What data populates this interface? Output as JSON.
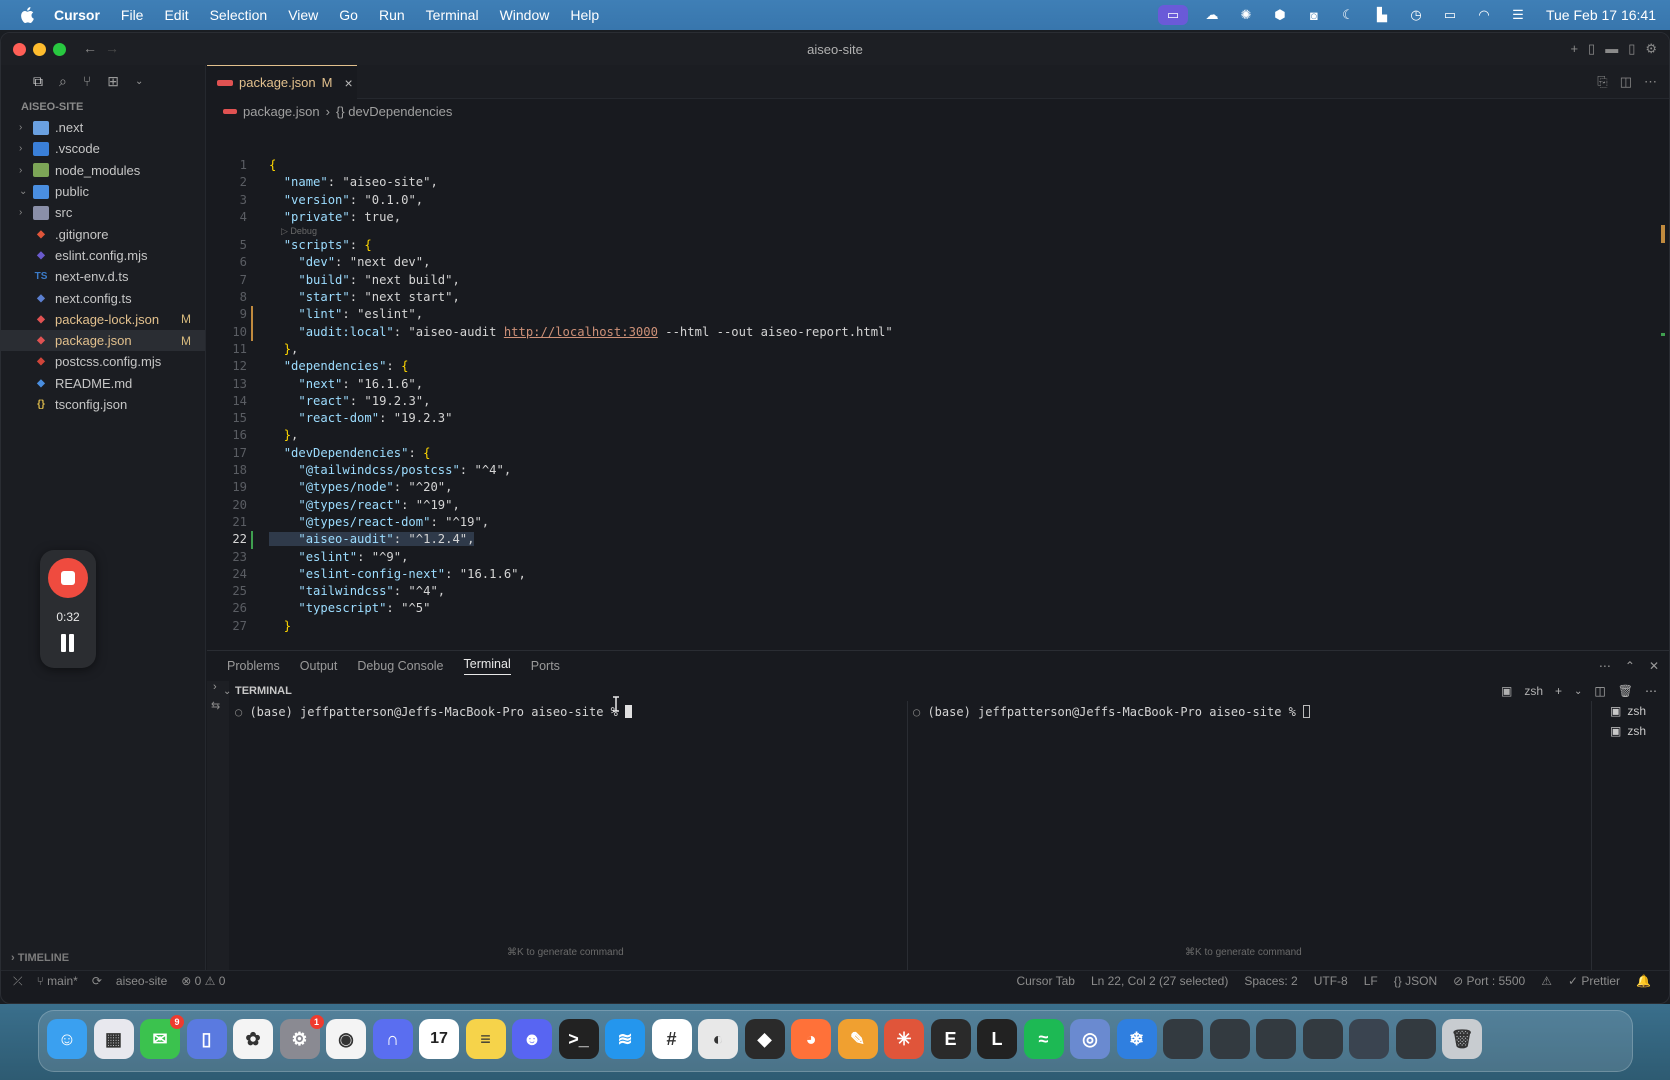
{
  "menubar": {
    "app_name": "Cursor",
    "items": [
      "File",
      "Edit",
      "Selection",
      "View",
      "Go",
      "Run",
      "Terminal",
      "Window",
      "Help"
    ],
    "clock": "Tue Feb 17  16:41"
  },
  "window": {
    "title": "aiseo-site"
  },
  "explorer": {
    "section_title": "AISEO-SITE",
    "items": [
      {
        "name": ".next",
        "type": "folder",
        "icon": "folder-icon",
        "color": "#6aa0e0"
      },
      {
        "name": ".vscode",
        "type": "folder",
        "icon": "folder-icon",
        "color": "#3a7fd8"
      },
      {
        "name": "node_modules",
        "type": "folder",
        "icon": "folder-icon",
        "color": "#7ca557"
      },
      {
        "name": "public",
        "type": "folder",
        "icon": "folder-open-icon",
        "color": "#4a8ee0"
      },
      {
        "name": "src",
        "type": "folder",
        "icon": "folder-icon",
        "color": "#8a8fa8"
      },
      {
        "name": ".gitignore",
        "type": "file",
        "icon": "git-icon",
        "color": "#e0553a"
      },
      {
        "name": "eslint.config.mjs",
        "type": "file",
        "icon": "eslint-icon",
        "color": "#6a5acd"
      },
      {
        "name": "next-env.d.ts",
        "type": "file",
        "icon": "ts-icon",
        "color": "#3b7bc8"
      },
      {
        "name": "next.config.ts",
        "type": "file",
        "icon": "next-icon",
        "color": "#5b7fd0"
      },
      {
        "name": "package-lock.json",
        "type": "file",
        "icon": "npm-icon",
        "color": "#e05252",
        "badge": "M"
      },
      {
        "name": "package.json",
        "type": "file",
        "icon": "npm-icon",
        "color": "#e05252",
        "badge": "M"
      },
      {
        "name": "postcss.config.mjs",
        "type": "file",
        "icon": "postcss-icon",
        "color": "#d0453a"
      },
      {
        "name": "README.md",
        "type": "file",
        "icon": "markdown-icon",
        "color": "#4a8ee0"
      },
      {
        "name": "tsconfig.json",
        "type": "file",
        "icon": "json-icon",
        "color": "#d7b64a"
      }
    ],
    "timeline_label": "TIMELINE"
  },
  "recorder": {
    "elapsed": "0:32"
  },
  "editor": {
    "tab": {
      "name": "package.json",
      "mark": "M"
    },
    "breadcrumb": [
      "package.json",
      "{} devDependencies"
    ],
    "debug_lens": "▷ Debug",
    "lines": [
      {
        "n": "1",
        "text": "{"
      },
      {
        "n": "2",
        "text": "  \"name\": \"aiseo-site\","
      },
      {
        "n": "3",
        "text": "  \"version\": \"0.1.0\","
      },
      {
        "n": "4",
        "text": "  \"private\": true,"
      },
      {
        "n": "5",
        "text": "  \"scripts\": {"
      },
      {
        "n": "6",
        "text": "    \"dev\": \"next dev\","
      },
      {
        "n": "7",
        "text": "    \"build\": \"next build\","
      },
      {
        "n": "8",
        "text": "    \"start\": \"next start\","
      },
      {
        "n": "9",
        "text": "    \"lint\": \"eslint\","
      },
      {
        "n": "10",
        "text": "    \"audit:local\": \"aiseo-audit http://localhost:3000 --html --out aiseo-report.html\""
      },
      {
        "n": "11",
        "text": "  },"
      },
      {
        "n": "12",
        "text": "  \"dependencies\": {"
      },
      {
        "n": "13",
        "text": "    \"next\": \"16.1.6\","
      },
      {
        "n": "14",
        "text": "    \"react\": \"19.2.3\","
      },
      {
        "n": "15",
        "text": "    \"react-dom\": \"19.2.3\""
      },
      {
        "n": "16",
        "text": "  },"
      },
      {
        "n": "17",
        "text": "  \"devDependencies\": {"
      },
      {
        "n": "18",
        "text": "    \"@tailwindcss/postcss\": \"^4\","
      },
      {
        "n": "19",
        "text": "    \"@types/node\": \"^20\","
      },
      {
        "n": "20",
        "text": "    \"@types/react\": \"^19\","
      },
      {
        "n": "21",
        "text": "    \"@types/react-dom\": \"^19\","
      },
      {
        "n": "22",
        "text": "    \"aiseo-audit\": \"^1.2.4\","
      },
      {
        "n": "23",
        "text": "    \"eslint\": \"^9\","
      },
      {
        "n": "24",
        "text": "    \"eslint-config-next\": \"16.1.6\","
      },
      {
        "n": "25",
        "text": "    \"tailwindcss\": \"^4\","
      },
      {
        "n": "26",
        "text": "    \"typescript\": \"^5\""
      },
      {
        "n": "27",
        "text": "  }"
      }
    ],
    "active_line": "22"
  },
  "panel": {
    "tabs": [
      "Problems",
      "Output",
      "Debug Console",
      "Terminal",
      "Ports"
    ],
    "active_tab": "Terminal",
    "terminal_header": "TERMINAL",
    "shell_label": "zsh",
    "prompt_left": "(base) jeffpatterson@Jeffs-MacBook-Pro aiseo-site % ",
    "prompt_right": "(base) jeffpatterson@Jeffs-MacBook-Pro aiseo-site % ",
    "hint_left": "⌘K to generate command",
    "hint_right": "⌘K to generate command",
    "terminal_list": [
      "zsh",
      "zsh"
    ]
  },
  "statusbar": {
    "branch": "main*",
    "workspace": "aiseo-site",
    "problems": "⊗ 0 ⚠ 0",
    "cursor_tab": "Cursor Tab",
    "position": "Ln 22, Col 2 (27 selected)",
    "spaces": "Spaces: 2",
    "encoding": "UTF-8",
    "eol": "LF",
    "language": "{} JSON",
    "port": "⊘ Port : 5500",
    "prettier": "✓ Prettier"
  },
  "dock": {
    "apps": [
      {
        "name": "finder",
        "icon": "finder-icon",
        "color": "#3aa0f0",
        "glyph": "☺"
      },
      {
        "name": "launchpad",
        "icon": "launchpad-icon",
        "color": "#e8e8ee",
        "glyph": "▦"
      },
      {
        "name": "messages",
        "icon": "messages-icon",
        "color": "#3bc24e",
        "glyph": "✉",
        "badge": "9"
      },
      {
        "name": "simulator",
        "icon": "simulator-icon",
        "color": "#5a7ae0",
        "glyph": "▯"
      },
      {
        "name": "photos",
        "icon": "photos-icon",
        "color": "#f4f4f4",
        "glyph": "✿"
      },
      {
        "name": "system-settings",
        "icon": "settings-icon",
        "color": "#8a8a92",
        "glyph": "⚙",
        "badge": "1"
      },
      {
        "name": "chrome",
        "icon": "chrome-icon",
        "color": "#f4f4f4",
        "glyph": "◉"
      },
      {
        "name": "arc",
        "icon": "arc-icon",
        "color": "#5a6ef0",
        "glyph": "∩"
      },
      {
        "name": "calendar",
        "icon": "calendar-icon",
        "color": "#ffffff",
        "glyph": "17"
      },
      {
        "name": "notes",
        "icon": "notes-icon",
        "color": "#f6d34a",
        "glyph": "≡"
      },
      {
        "name": "discord",
        "icon": "discord-icon",
        "color": "#5865f2",
        "glyph": "☻"
      },
      {
        "name": "terminal",
        "icon": "terminal-icon",
        "color": "#222222",
        "glyph": ">_"
      },
      {
        "name": "docker",
        "icon": "docker-icon",
        "color": "#2496ed",
        "glyph": "≋"
      },
      {
        "name": "slack",
        "icon": "slack-icon",
        "color": "#ffffff",
        "glyph": "#"
      },
      {
        "name": "linear",
        "icon": "linear-icon",
        "color": "#e8e8e8",
        "glyph": "◐"
      },
      {
        "name": "cursor",
        "icon": "cursor-icon",
        "color": "#2a2a2a",
        "glyph": "◆"
      },
      {
        "name": "firefox",
        "icon": "firefox-icon",
        "color": "#ff7139",
        "glyph": "◕"
      },
      {
        "name": "pages",
        "icon": "pages-icon",
        "color": "#f0a030",
        "glyph": "✎"
      },
      {
        "name": "claude",
        "icon": "claude-icon",
        "color": "#e0553a",
        "glyph": "✳"
      },
      {
        "name": "elgato",
        "icon": "elgato-icon",
        "color": "#2a2a2a",
        "glyph": "E"
      },
      {
        "name": "lovable",
        "icon": "lovable-icon",
        "color": "#222222",
        "glyph": "L"
      },
      {
        "name": "spotify",
        "icon": "spotify-icon",
        "color": "#1db954",
        "glyph": "≈"
      },
      {
        "name": "disk",
        "icon": "disk-icon",
        "color": "#6a8ad0",
        "glyph": "◎"
      },
      {
        "name": "xcode-helper",
        "icon": "gear-blue-icon",
        "color": "#2f7fe0",
        "glyph": "❄"
      },
      {
        "name": "window-1",
        "icon": "window-thumb-icon",
        "color": "#333a40",
        "glyph": ""
      },
      {
        "name": "window-2",
        "icon": "window-thumb-icon",
        "color": "#333a40",
        "glyph": ""
      },
      {
        "name": "window-3",
        "icon": "window-thumb-icon",
        "color": "#333a40",
        "glyph": ""
      },
      {
        "name": "window-4",
        "icon": "window-thumb-icon",
        "color": "#333a40",
        "glyph": ""
      },
      {
        "name": "window-5",
        "icon": "window-thumb-icon",
        "color": "#3a4450",
        "glyph": ""
      },
      {
        "name": "window-6",
        "icon": "window-thumb-icon",
        "color": "#333a40",
        "glyph": ""
      },
      {
        "name": "trash",
        "icon": "trash-icon",
        "color": "#c8ccd0",
        "glyph": "🗑"
      }
    ]
  }
}
